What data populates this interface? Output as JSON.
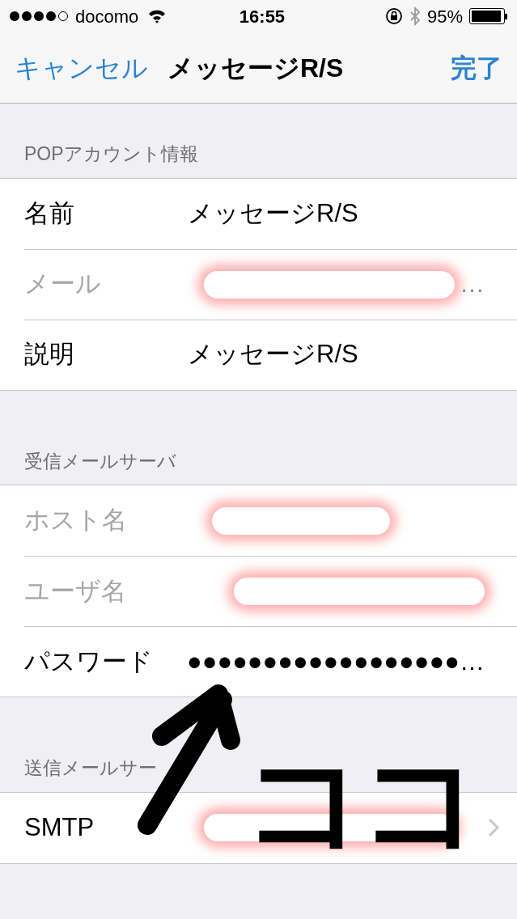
{
  "status_bar": {
    "signal_dots": [
      {
        "filled": true
      },
      {
        "filled": true
      },
      {
        "filled": true
      },
      {
        "filled": true
      },
      {
        "filled": false
      }
    ],
    "carrier": "docomo",
    "time": "16:55",
    "battery": "95%",
    "level": 0.95
  },
  "nav": {
    "cancel": "キャンセル",
    "title": "メッセージR/S",
    "done": "完了"
  },
  "sections": [
    {
      "header": "POPアカウント情報",
      "rows": [
        {
          "label": "名前",
          "value": "メッセージR/S",
          "dimmed": false,
          "redacted": false,
          "chevron": false
        },
        {
          "label": "メール",
          "value": "…",
          "dimmed": true,
          "redacted": true,
          "chevron": false
        },
        {
          "label": "説明",
          "value": "メッセージR/S",
          "dimmed": false,
          "redacted": false,
          "chevron": false
        }
      ]
    },
    {
      "header": "受信メールサーバ",
      "rows": [
        {
          "label": "ホスト名",
          "value": "",
          "dimmed": true,
          "redacted": true,
          "chevron": false
        },
        {
          "label": "ユーザ名",
          "value": "",
          "dimmed": true,
          "redacted": true,
          "chevron": false
        },
        {
          "label": "パスワード",
          "value": "●●●●●●●●●●●●●●●●●●…",
          "dimmed": false,
          "redacted": false,
          "chevron": false
        }
      ]
    },
    {
      "header": "送信メールサー",
      "rows": [
        {
          "label": "SMTP",
          "value": "",
          "dimmed": false,
          "redacted": true,
          "chevron": true
        }
      ]
    }
  ],
  "annotation": {
    "text": "ココ"
  }
}
